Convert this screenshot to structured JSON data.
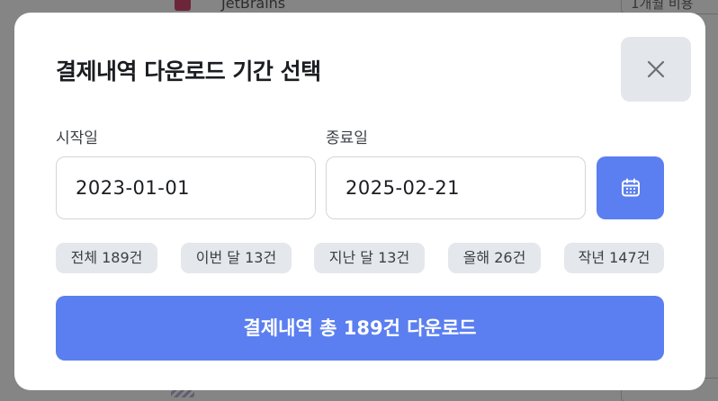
{
  "background": {
    "app_name": "JetBrains",
    "plan_label": "1개월 비용"
  },
  "modal": {
    "title": "결제내역 다운로드 기간 선택",
    "close_icon": "close-icon",
    "start": {
      "label": "시작일",
      "value": "2023-01-01"
    },
    "end": {
      "label": "종료일",
      "value": "2025-02-21"
    },
    "calendar_icon": "calendar-icon",
    "quick_ranges": [
      {
        "label": "전체 189건"
      },
      {
        "label": "이번 달 13건"
      },
      {
        "label": "지난 달 13건"
      },
      {
        "label": "올해 26건"
      },
      {
        "label": "작년 147건"
      }
    ],
    "download_label": "결제내역 총 189건 다운로드"
  },
  "colors": {
    "accent": "#5b7ff0",
    "chip_bg": "#e4e7eb",
    "close_bg": "#e3e6ea",
    "title_text": "#1b1d22"
  }
}
